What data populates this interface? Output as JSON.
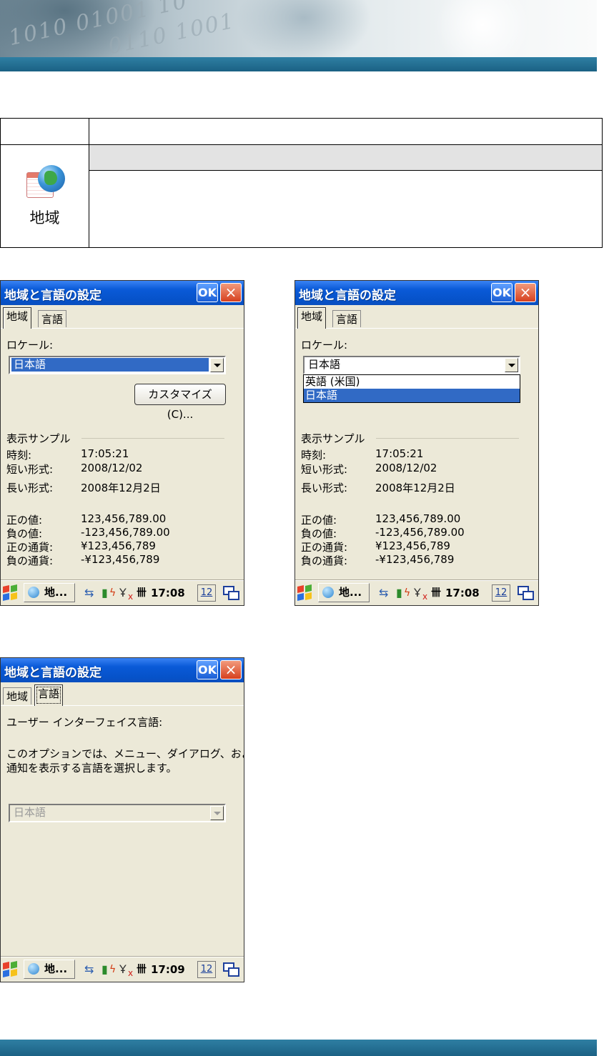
{
  "info_table": {
    "header_left": "",
    "header_right": "",
    "icon_label": "地域",
    "gray_bar_text": "",
    "description": ""
  },
  "screens": [
    {
      "title": "地域と言語の設定",
      "ok": "OK",
      "close": "×",
      "tabs": [
        "地域",
        "言語"
      ],
      "active_tab": 0,
      "locale_label": "ロケール:",
      "locale_value": "日本語",
      "customize_button": "カスタマイズ(C)...",
      "sample_label": "表示サンプル",
      "rows": [
        {
          "label": "時刻:",
          "value": "17:05:21"
        },
        {
          "label": "短い形式:",
          "value": "2008/12/02"
        },
        {
          "label": "長い形式:",
          "value": "2008年12月2日"
        }
      ],
      "rows2": [
        {
          "label": "正の値:",
          "value": "123,456,789.00"
        },
        {
          "label": "負の値:",
          "value": "-123,456,789.00"
        },
        {
          "label": "正の通貨:",
          "value": "¥123,456,789"
        },
        {
          "label": "負の通貨:",
          "value": "-¥123,456,789"
        }
      ],
      "taskbar": {
        "app": "地...",
        "time": "17:08",
        "kb": "12"
      }
    },
    {
      "title": "地域と言語の設定",
      "ok": "OK",
      "close": "×",
      "tabs": [
        "地域",
        "言語"
      ],
      "active_tab": 0,
      "locale_label": "ロケール:",
      "locale_value": "日本語",
      "dropdown_options": [
        "英語 (米国)",
        "日本語"
      ],
      "dropdown_selected": 1,
      "sample_label": "表示サンプル",
      "rows": [
        {
          "label": "時刻:",
          "value": "17:05:21"
        },
        {
          "label": "短い形式:",
          "value": "2008/12/02"
        },
        {
          "label": "長い形式:",
          "value": "2008年12月2日"
        }
      ],
      "rows2": [
        {
          "label": "正の値:",
          "value": "123,456,789.00"
        },
        {
          "label": "負の値:",
          "value": "-123,456,789.00"
        },
        {
          "label": "正の通貨:",
          "value": "¥123,456,789"
        },
        {
          "label": "負の通貨:",
          "value": "-¥123,456,789"
        }
      ],
      "taskbar": {
        "app": "地...",
        "time": "17:08",
        "kb": "12"
      }
    },
    {
      "title": "地域と言語の設定",
      "ok": "OK",
      "close": "×",
      "tabs": [
        "地域",
        "言語"
      ],
      "active_tab": 1,
      "ui_lang_label": "ユーザー インターフェイス言語:",
      "ui_lang_desc_1": "このオプションでは、メニュー、ダイアログ、および",
      "ui_lang_desc_2": "通知を表示する言語を選択します。",
      "ui_lang_value": "日本語",
      "taskbar": {
        "app": "地...",
        "time": "17:09",
        "kb": "12"
      }
    }
  ],
  "colors": {
    "title_blue": "#0652c9",
    "dialog_bg": "#ece9d8",
    "highlight": "#316ac5",
    "banner_bar": "#1b6184"
  }
}
